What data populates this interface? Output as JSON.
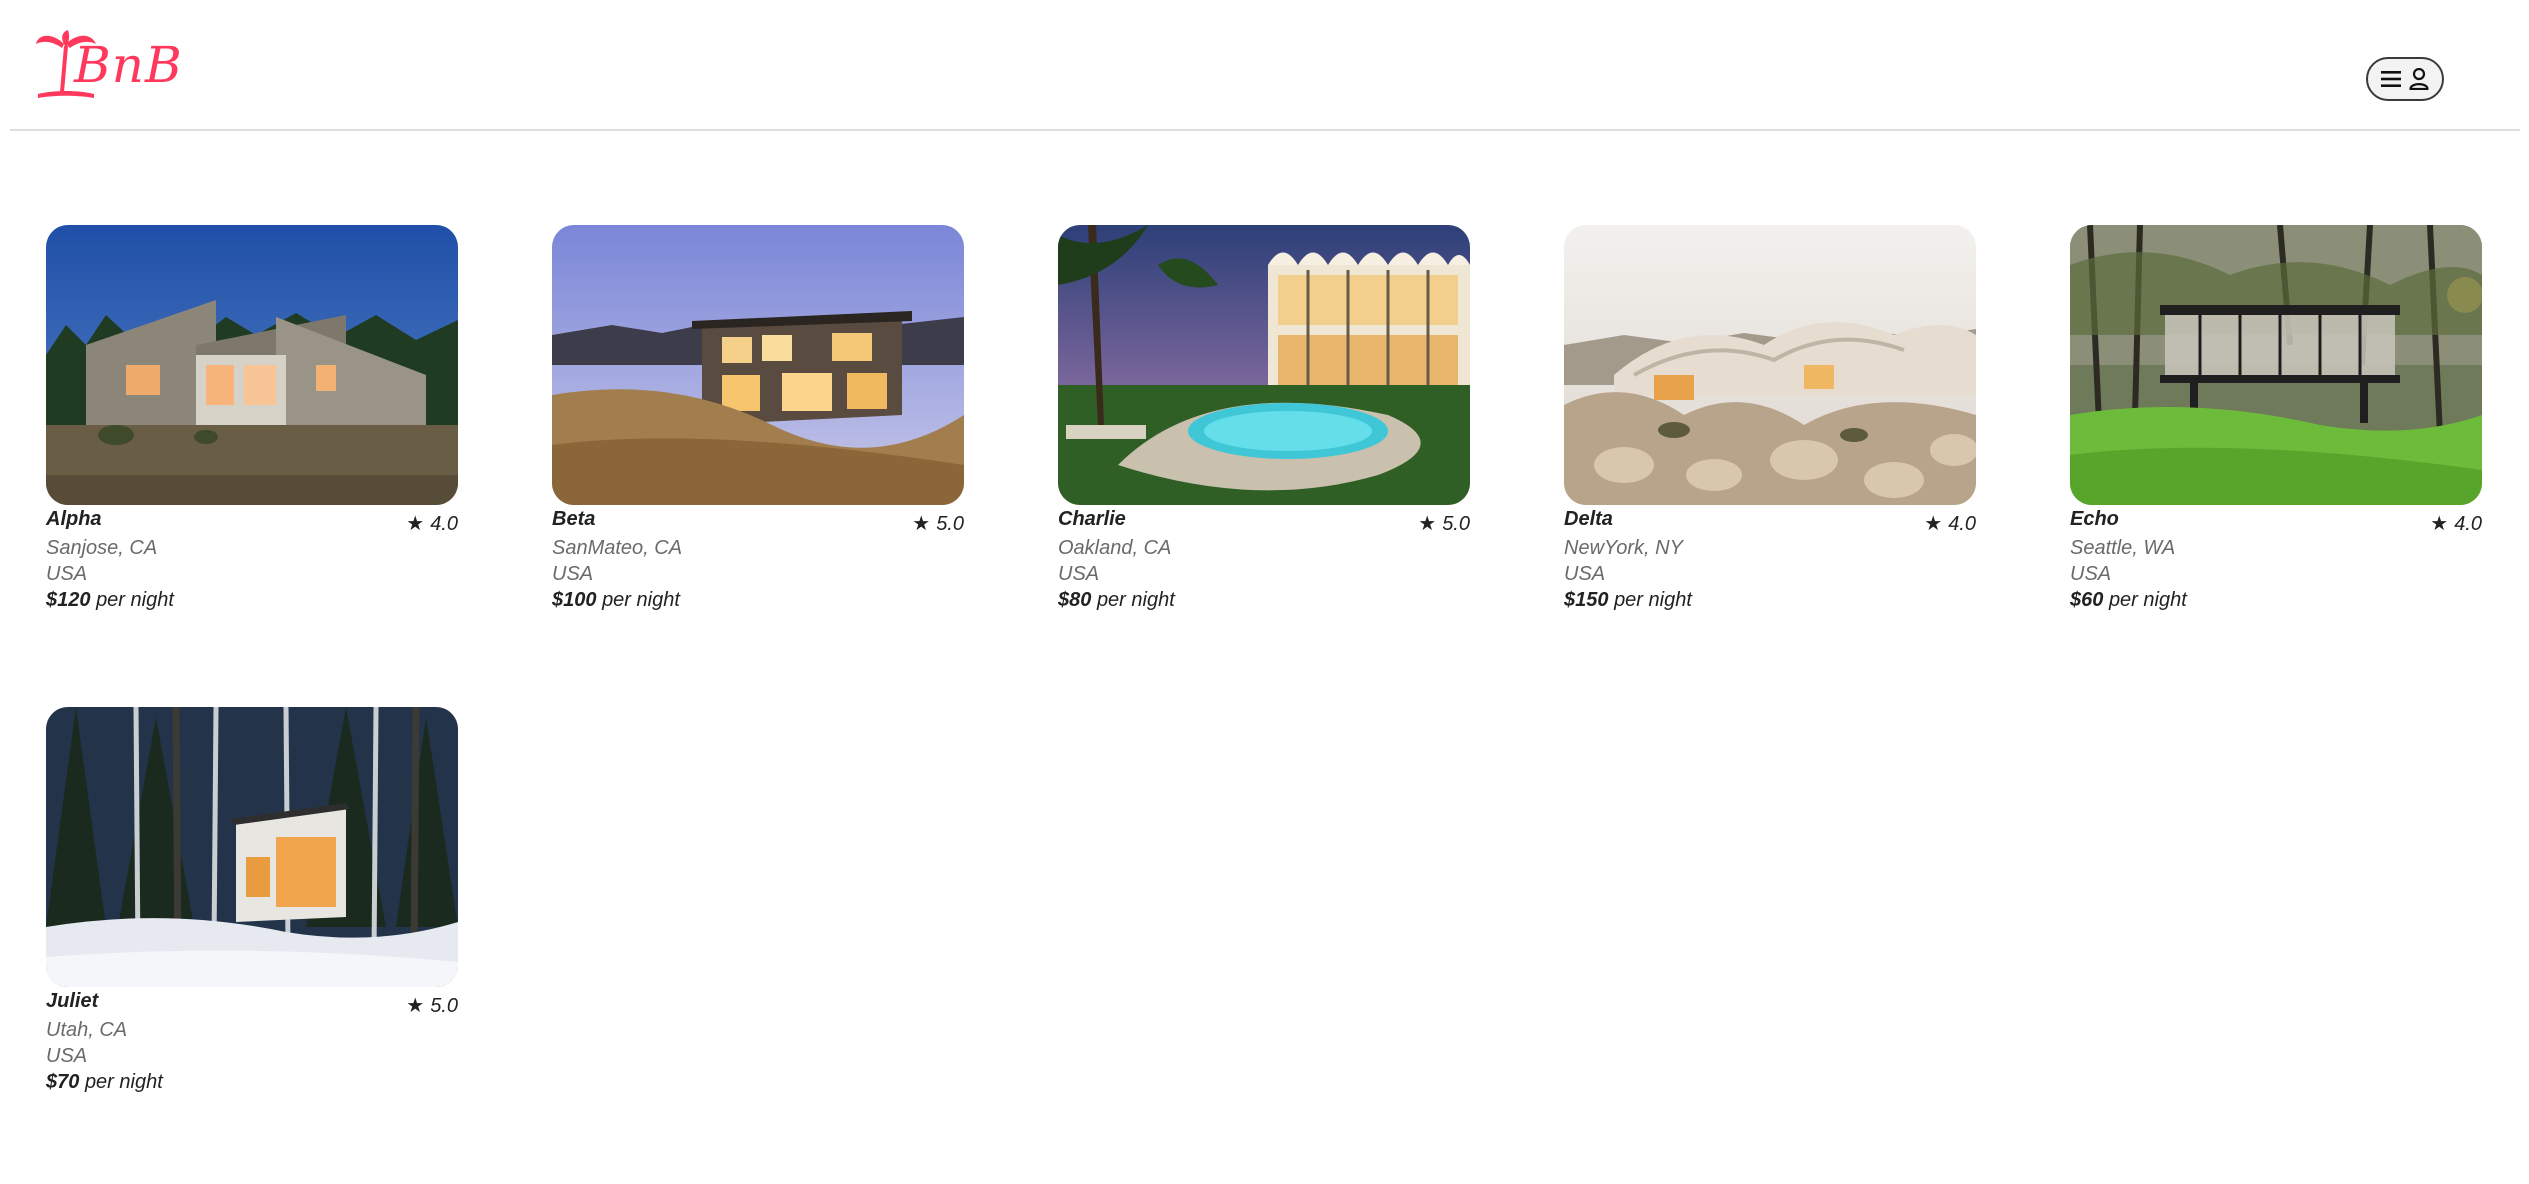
{
  "brand": {
    "logo_text": "BnB",
    "accent_color": "#ff385c"
  },
  "header": {
    "menu_icon": "hamburger-icon",
    "user_icon": "user-icon"
  },
  "listings": [
    {
      "name": "Alpha",
      "rating": "4.0",
      "location": "Sanjose, CA",
      "country": "USA",
      "price": "$120",
      "price_suffix": "per night",
      "photo": "modern wooden barn-style house at dusk"
    },
    {
      "name": "Beta",
      "rating": "5.0",
      "location": "SanMateo, CA",
      "country": "USA",
      "price": "$100",
      "price_suffix": "per night",
      "photo": "two-story modern house on a dry grassy hill"
    },
    {
      "name": "Charlie",
      "rating": "5.0",
      "location": "Oakland, CA",
      "country": "USA",
      "price": "$80",
      "price_suffix": "per night",
      "photo": "arched villa with swimming pool and palm trees"
    },
    {
      "name": "Delta",
      "rating": "4.0",
      "location": "NewYork, NY",
      "country": "USA",
      "price": "$150",
      "price_suffix": "per night",
      "photo": "organic desert house among boulders"
    },
    {
      "name": "Echo",
      "rating": "4.0",
      "location": "Seattle, WA",
      "country": "USA",
      "price": "$60",
      "price_suffix": "per night",
      "photo": "glass pavilion house in a green forest"
    },
    {
      "name": "Juliet",
      "rating": "5.0",
      "location": "Utah, CA",
      "country": "USA",
      "price": "$70",
      "price_suffix": "per night",
      "photo": "small cabin in a snowy pine forest"
    }
  ]
}
